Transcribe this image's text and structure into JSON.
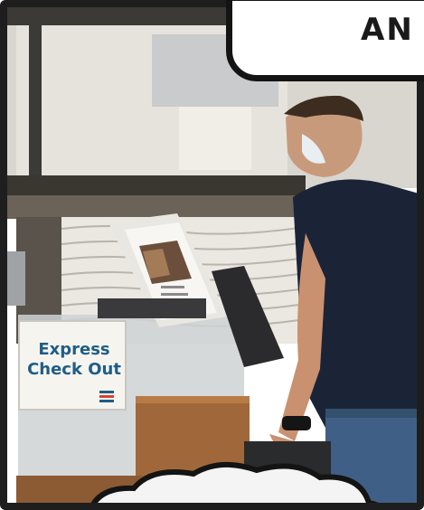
{
  "caption": {
    "text": "AN"
  },
  "sign": {
    "line1": "Express",
    "line2": "Check Out"
  },
  "colors": {
    "sign_text": "#1f5d86",
    "shirt": "#1b2437",
    "wood": "#a0683a",
    "frame": "#1e1e1e"
  },
  "icons": {
    "sign_logo": "stripes-logo-icon",
    "watch": "smartwatch-icon"
  }
}
